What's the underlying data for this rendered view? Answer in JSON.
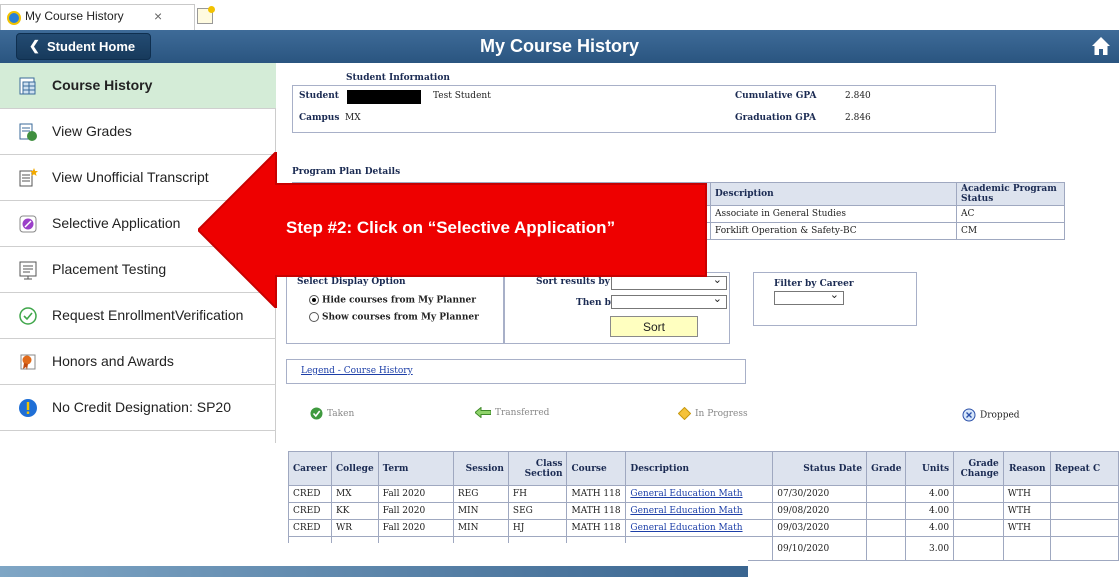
{
  "browser": {
    "tab_title": "My Course History",
    "tab_close": "×"
  },
  "header": {
    "home_label": "Student Home",
    "title": "My Course History"
  },
  "sidebar": {
    "items": [
      {
        "label": "Course History",
        "icon": "table-icon"
      },
      {
        "label": "View Grades",
        "icon": "grades-icon"
      },
      {
        "label": "View Unofficial Transcript",
        "icon": "document-star-icon"
      },
      {
        "label": "Selective Application",
        "icon": "application-icon"
      },
      {
        "label": "Placement Testing",
        "icon": "test-icon"
      },
      {
        "label": "Request EnrollmentVerification",
        "icon": "check-circle-icon"
      },
      {
        "label": "Honors and Awards",
        "icon": "award-icon"
      },
      {
        "label": "No Credit Designation: SP20",
        "icon": "alert-icon"
      }
    ]
  },
  "student_info": {
    "title": "Student Information",
    "student_label": "Student",
    "student_name": "Test Student",
    "campus_label": "Campus",
    "campus_value": "MX",
    "cum_gpa_label": "Cumulative GPA",
    "cum_gpa_value": "2.840",
    "grad_gpa_label": "Graduation GPA",
    "grad_gpa_value": "2.846"
  },
  "program_plan": {
    "title": "Program Plan Details",
    "headers": {
      "description": "Description",
      "status_l1": "Academic Program",
      "status_l2": "Status"
    },
    "rows": [
      {
        "description": "Associate in General Studies",
        "status": "AC"
      },
      {
        "description": "Forklift Operation & Safety-BC",
        "status": "CM"
      }
    ]
  },
  "display_option": {
    "title": "Select Display Option",
    "hide_label": "Hide courses from My Planner",
    "show_label": "Show courses from My Planner"
  },
  "sort": {
    "sort_by_label": "Sort results by",
    "then_by_label": "Then by",
    "button_label": "Sort"
  },
  "filter": {
    "label": "Filter by Career"
  },
  "legend": {
    "link_label": "Legend - Course History",
    "taken": "Taken",
    "transferred": "Transferred",
    "in_progress": "In Progress",
    "dropped": "Dropped"
  },
  "callout": {
    "text": "Step #2: Click on “Selective Application”",
    "color": "#ee0000"
  },
  "course_table": {
    "headers": {
      "career": "Career",
      "college": "College",
      "term": "Term",
      "session": "Session",
      "class_l1": "Class",
      "class_l2": "Section",
      "course": "Course",
      "description": "Description",
      "status_date": "Status Date",
      "grade": "Grade",
      "units": "Units",
      "grade_change_l1": "Grade",
      "grade_change_l2": "Change",
      "reason": "Reason",
      "repeat": "Repeat C"
    },
    "rows": [
      {
        "career": "CRED",
        "college": "MX",
        "term": "Fall 2020",
        "session": "REG",
        "section": "FH",
        "course": "MATH 118",
        "description": "General Education Math",
        "status_date": "07/30/2020",
        "units": "4.00",
        "reason": "WTH"
      },
      {
        "career": "CRED",
        "college": "KK",
        "term": "Fall 2020",
        "session": "MIN",
        "section": "SEG",
        "course": "MATH 118",
        "description": "General Education Math",
        "status_date": "09/08/2020",
        "units": "4.00",
        "reason": "WTH"
      },
      {
        "career": "CRED",
        "college": "WR",
        "term": "Fall 2020",
        "session": "MIN",
        "section": "HJ",
        "course": "MATH 118",
        "description": "General Education Math",
        "status_date": "09/03/2020",
        "units": "4.00",
        "reason": "WTH"
      },
      {
        "career": "",
        "college": "",
        "term": "",
        "session": "",
        "section": "",
        "course": "",
        "description": "",
        "status_date": "09/10/2020",
        "units": "3.00",
        "reason": ""
      }
    ]
  }
}
